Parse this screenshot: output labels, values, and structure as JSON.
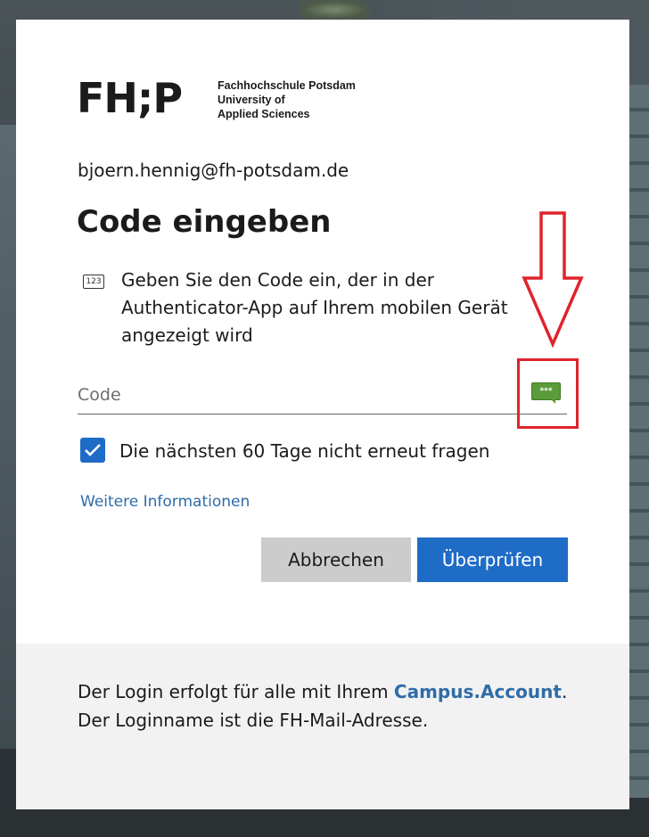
{
  "logo": {
    "mark": "FH;P",
    "line1": "Fachhochschule Potsdam",
    "line2": "University of",
    "line3": "Applied Sciences"
  },
  "identity": "bjoern.hennig@fh-potsdam.de",
  "title": "Code eingeben",
  "instruction": {
    "icon_text": "123",
    "text": "Geben Sie den Code ein, der in der Authenticator-App auf Ihrem mobilen Gerät angezeigt wird"
  },
  "code_input": {
    "placeholder": "Code",
    "value": ""
  },
  "sms_icon_text": "***",
  "remember": {
    "checked": true,
    "label": "Die nächsten 60 Tage nicht erneut fragen"
  },
  "more_info_label": "Weitere Informationen",
  "buttons": {
    "cancel": "Abbrechen",
    "verify": "Überprüfen"
  },
  "footer": {
    "prefix": "Der Login erfolgt für alle mit Ihrem ",
    "link": "Campus.Account",
    "suffix": ". Der Loginname ist die FH-Mail-Adresse."
  },
  "colors": {
    "accent": "#1f6cc7",
    "link": "#2f6ca8",
    "annotation": "#e0232b",
    "sms_icon": "#5a9b3a"
  }
}
